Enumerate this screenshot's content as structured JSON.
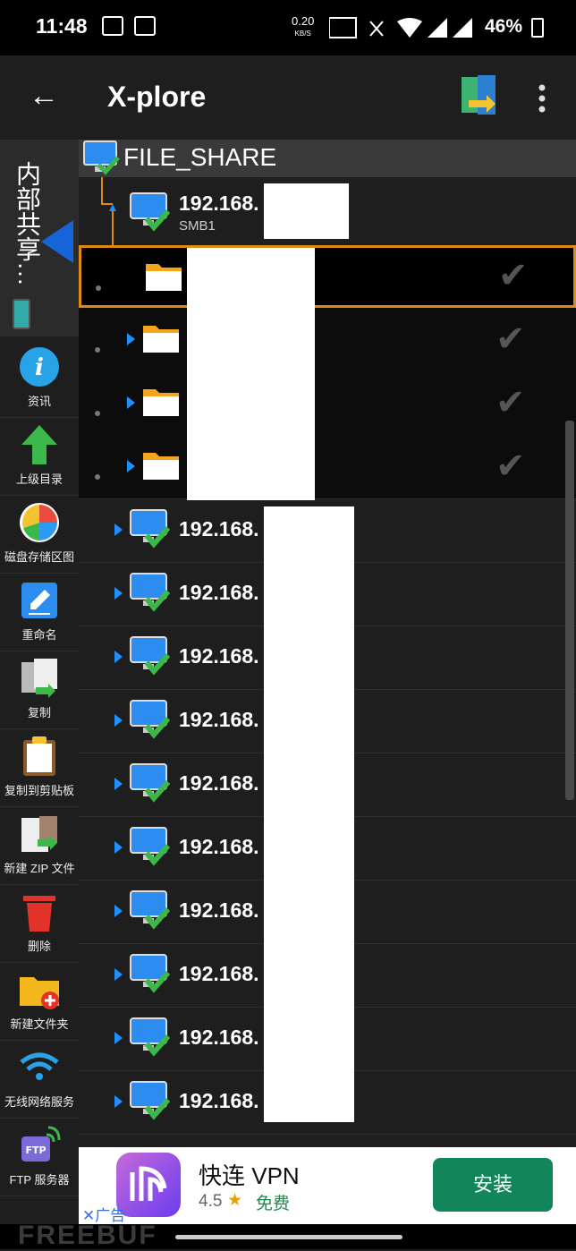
{
  "status": {
    "time": "11:48",
    "speed_value": "0.20",
    "speed_unit": "KB/S",
    "battery": "46%"
  },
  "appbar": {
    "title": "X-plore",
    "back_icon": "arrow-back-icon",
    "menu_icon": "overflow-menu-icon"
  },
  "sidebar": {
    "tab_label": "内部共享…",
    "items": [
      {
        "label": "资讯",
        "icon": "info-icon"
      },
      {
        "label": "上级目录",
        "icon": "up-arrow-icon"
      },
      {
        "label": "磁盘存储区图",
        "icon": "disk-map-icon"
      },
      {
        "label": "重命名",
        "icon": "rename-icon"
      },
      {
        "label": "复制",
        "icon": "copy-icon"
      },
      {
        "label": "复制到剪贴板",
        "icon": "clipboard-icon"
      },
      {
        "label": "新建 ZIP 文件",
        "icon": "zip-icon"
      },
      {
        "label": "删除",
        "icon": "trash-icon"
      },
      {
        "label": "新建文件夹",
        "icon": "new-folder-icon"
      },
      {
        "label": "无线网络服务",
        "icon": "wifi-icon"
      },
      {
        "label": "FTP 服务器",
        "icon": "ftp-icon"
      }
    ]
  },
  "tree": {
    "root_label": "FILE_SHARE",
    "server": {
      "ip": "192.168.",
      "protocol": "SMB1"
    },
    "hosts": [
      "192.168.",
      "192.168.",
      "192.168.",
      "192.168.",
      "192.168.",
      "192.168.",
      "192.168.",
      "192.168.",
      "192.168.",
      "192.168."
    ]
  },
  "ad": {
    "app_name": "快连 VPN",
    "rating": "4.5",
    "star": "★",
    "price": "免费",
    "install": "安装",
    "tag": "✕广告"
  },
  "watermark": "FREEBUF",
  "colors": {
    "accent": "#e08a16",
    "install_green": "#12855a",
    "link_blue": "#1e90ff"
  }
}
